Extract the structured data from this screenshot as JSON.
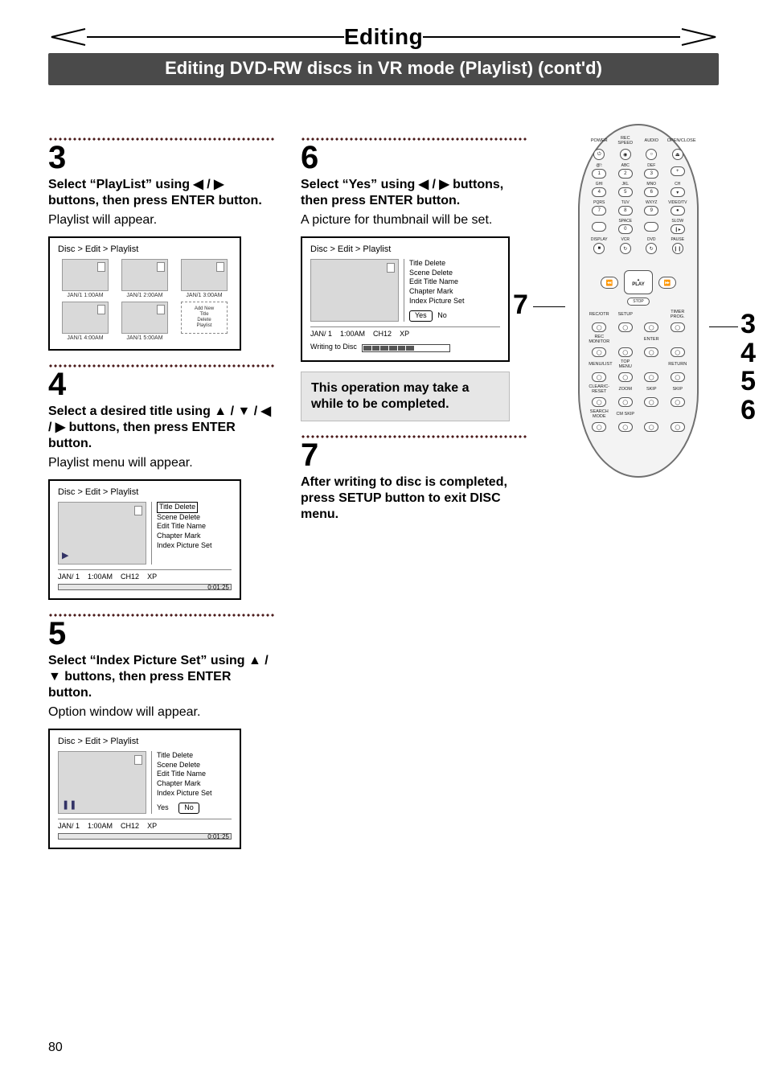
{
  "header": {
    "title": "Editing",
    "subtitle": "Editing DVD-RW discs in VR mode (Playlist) (cont'd)"
  },
  "steps": {
    "s3": {
      "num": "3",
      "head": "Select “PlayList” using ◀ / ▶ buttons, then press ENTER button.",
      "desc": "Playlist will appear.",
      "osd": {
        "breadcrumb": "Disc > Edit > Playlist",
        "thumbs": [
          "JAN/1  1:00AM",
          "JAN/1  2:00AM",
          "JAN/1  3:00AM",
          "JAN/1  4:00AM",
          "JAN/1  5:00AM"
        ],
        "addbox": [
          "Add  New",
          "Title",
          "Delete",
          "Playlist"
        ]
      }
    },
    "s4": {
      "num": "4",
      "head": "Select a desired title using ▲ / ▼ / ◀ / ▶ buttons, then press ENTER button.",
      "desc": "Playlist menu will appear.",
      "osd": {
        "breadcrumb": "Disc > Edit > Playlist",
        "menu": [
          "Title Delete",
          "Scene Delete",
          "Edit Title Name",
          "Chapter Mark",
          "Index Picture Set"
        ],
        "selected": "Title Delete",
        "status": {
          "date": "JAN/ 1",
          "time": "1:00AM",
          "ch": "CH12",
          "mode": "XP",
          "elapsed": "0:01:25"
        },
        "playmark": "▶"
      }
    },
    "s5": {
      "num": "5",
      "head": "Select “Index Picture Set” using ▲ / ▼ buttons, then press ENTER button.",
      "desc": "Option window will appear.",
      "osd": {
        "breadcrumb": "Disc > Edit > Playlist",
        "menu": [
          "Title Delete",
          "Scene Delete",
          "Edit Title Name",
          "Chapter Mark",
          "Index Picture Set"
        ],
        "yn_yes": "Yes",
        "yn_no": "No",
        "yn_sel": "No",
        "status": {
          "date": "JAN/ 1",
          "time": "1:00AM",
          "ch": "CH12",
          "mode": "XP",
          "elapsed": "0:01:25"
        },
        "playmark": "❚❚"
      }
    },
    "s6": {
      "num": "6",
      "head": "Select “Yes” using ◀ / ▶ buttons, then press ENTER button.",
      "desc": "A picture for thumbnail will be set.",
      "osd": {
        "breadcrumb": "Disc > Edit > Playlist",
        "menu": [
          "Title Delete",
          "Scene Delete",
          "Edit Title Name",
          "Chapter Mark",
          "Index Picture Set"
        ],
        "yn_yes": "Yes",
        "yn_no": "No",
        "yn_sel": "Yes",
        "status": {
          "date": "JAN/ 1",
          "time": "1:00AM",
          "ch": "CH12",
          "mode": "XP"
        },
        "writing": "Writing to Disc"
      }
    },
    "s7": {
      "num": "7",
      "head": "After writing to disc is completed, press SETUP button to exit DISC menu."
    },
    "note": "This operation may take a while to be completed."
  },
  "remote": {
    "toplabels": [
      "POWER",
      "REC SPEED",
      "AUDIO",
      "OPEN/CLOSE"
    ],
    "keypad": [
      {
        "sub": "@!:",
        "n": "1"
      },
      {
        "sub": "ABC",
        "n": "2"
      },
      {
        "sub": "DEF",
        "n": "3"
      },
      {
        "sub": "",
        "n": "+"
      },
      {
        "sub": "GHI",
        "n": "4"
      },
      {
        "sub": "JKL",
        "n": "5"
      },
      {
        "sub": "MNO",
        "n": "6"
      },
      {
        "sub": "CH",
        "n": "▾"
      },
      {
        "sub": "PQRS",
        "n": "7"
      },
      {
        "sub": "TUV",
        "n": "8"
      },
      {
        "sub": "WXYZ",
        "n": "9"
      },
      {
        "sub": "VIDEO/TV",
        "n": "●"
      },
      {
        "sub": "",
        "n": ""
      },
      {
        "sub": "SPACE",
        "n": "0"
      },
      {
        "sub": "",
        "n": ""
      },
      {
        "sub": "SLOW",
        "n": "❙▸"
      }
    ],
    "moderow": [
      {
        "lbl": "DISPLAY",
        "g": "■"
      },
      {
        "lbl": "VCR",
        "g": "↻"
      },
      {
        "lbl": "DVD",
        "g": "↻"
      },
      {
        "lbl": "PAUSE",
        "g": "❙❙"
      }
    ],
    "nav": {
      "left": "⏪",
      "right": "⏩",
      "play": "PLAY",
      "stop": "STOP",
      "up": "▴"
    },
    "rows": [
      [
        "REC/OTR",
        "SETUP",
        "",
        "TIMER PROG."
      ],
      [
        "REC MONITOR",
        "",
        "ENTER",
        ""
      ],
      [
        "MENU/LIST",
        "TOP MENU",
        "",
        "RETURN"
      ],
      [
        "CLEAR/C-RESET",
        "ZOOM",
        "SKIP",
        "SKIP"
      ],
      [
        "SEARCH MODE",
        "CM SKIP",
        "",
        ""
      ]
    ],
    "callouts": {
      "left": "7",
      "right": [
        "3",
        "4",
        "5",
        "6"
      ]
    }
  },
  "pageNumber": "80"
}
